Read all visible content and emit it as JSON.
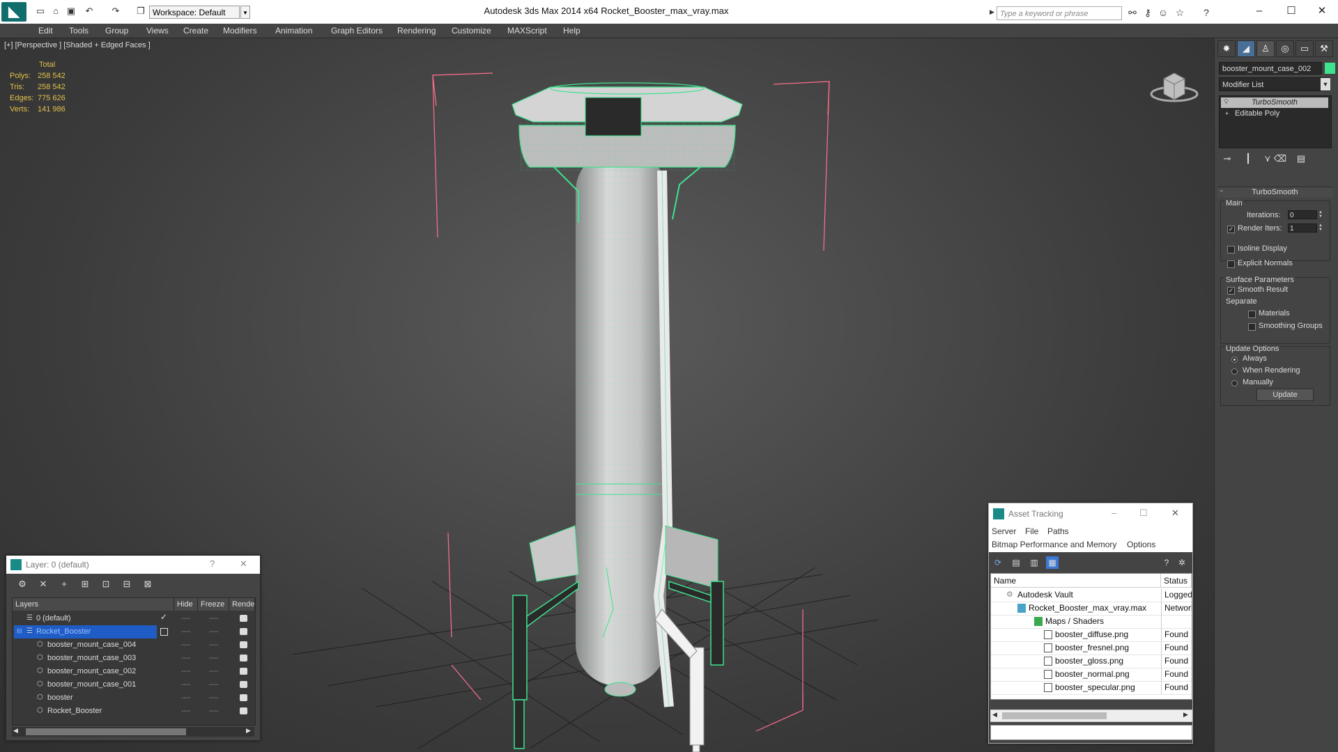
{
  "window": {
    "title": "Autodesk 3ds Max  2014 x64      Rocket_Booster_max_vray.max",
    "workspace": "Workspace: Default",
    "search_placeholder": "Type a keyword or phrase"
  },
  "menu": [
    "Edit",
    "Tools",
    "Group",
    "Views",
    "Create",
    "Modifiers",
    "Animation",
    "Graph Editors",
    "Rendering",
    "Customize",
    "MAXScript",
    "Help"
  ],
  "viewport": {
    "label": "[+] [Perspective ] [Shaded + Edged Faces ]",
    "stats": {
      "header": "Total",
      "rows": [
        {
          "label": "Polys:",
          "value": "258 542"
        },
        {
          "label": "Tris:",
          "value": "258 542"
        },
        {
          "label": "Edges:",
          "value": "775 626"
        },
        {
          "label": "Verts:",
          "value": "141 986"
        }
      ]
    }
  },
  "command_panel": {
    "object_name": "booster_mount_case_002",
    "object_color": "#3ee38f",
    "modifier_list": "Modifier List",
    "stack": [
      "TurboSmooth",
      "Editable Poly"
    ],
    "rollout_title": "TurboSmooth",
    "main_label": "Main",
    "iterations_label": "Iterations:",
    "iterations_value": "0",
    "render_iters_label": "Render Iters:",
    "render_iters_value": "1",
    "render_iters_checked": true,
    "isoline_label": "Isoline Display",
    "explicit_normals_label": "Explicit Normals",
    "surface_params_label": "Surface Parameters",
    "smooth_result_label": "Smooth Result",
    "separate_label": "Separate",
    "materials_label": "Materials",
    "smoothing_groups_label": "Smoothing Groups",
    "update_options_label": "Update Options",
    "always_label": "Always",
    "when_rendering_label": "When Rendering",
    "manually_label": "Manually",
    "update_button": "Update"
  },
  "layer_window": {
    "title": "Layer: 0 (default)",
    "help": "?",
    "close": "✕",
    "columns": [
      "Layers",
      "Hide",
      "Freeze",
      "Rende"
    ],
    "rows": [
      {
        "name": "0 (default)",
        "level": 1,
        "selected": false
      },
      {
        "name": "Rocket_Booster",
        "level": 1,
        "selected": true
      },
      {
        "name": "booster_mount_case_004",
        "level": 2,
        "selected": false
      },
      {
        "name": "booster_mount_case_003",
        "level": 2,
        "selected": false
      },
      {
        "name": "booster_mount_case_002",
        "level": 2,
        "selected": false
      },
      {
        "name": "booster_mount_case_001",
        "level": 2,
        "selected": false
      },
      {
        "name": "booster",
        "level": 2,
        "selected": false
      },
      {
        "name": "Rocket_Booster",
        "level": 2,
        "selected": false
      }
    ],
    "dash": "----"
  },
  "asset_window": {
    "title": "Asset Tracking",
    "menus_row1": [
      "Server",
      "File",
      "Paths"
    ],
    "menus_row2": [
      "Bitmap Performance and Memory",
      "Options"
    ],
    "columns": [
      "Name",
      "Status"
    ],
    "rows": [
      {
        "name": "Autodesk Vault",
        "status": "Logged",
        "level": 1
      },
      {
        "name": "Rocket_Booster_max_vray.max",
        "status": "Network",
        "level": 2
      },
      {
        "name": "Maps / Shaders",
        "status": "",
        "level": 3
      },
      {
        "name": "booster_diffuse.png",
        "status": "Found",
        "level": 4
      },
      {
        "name": "booster_fresnel.png",
        "status": "Found",
        "level": 4
      },
      {
        "name": "booster_gloss.png",
        "status": "Found",
        "level": 4
      },
      {
        "name": "booster_normal.png",
        "status": "Found",
        "level": 4
      },
      {
        "name": "booster_specular.png",
        "status": "Found",
        "level": 4
      }
    ]
  }
}
